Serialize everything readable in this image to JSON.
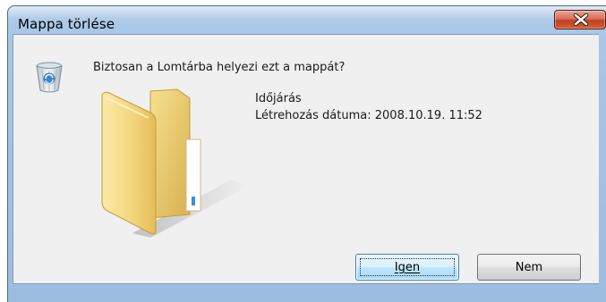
{
  "window": {
    "title": "Mappa törlése"
  },
  "dialog": {
    "question": "Biztosan a Lomtárba helyezi ezt a mappát?",
    "folder_name": "Időjárás",
    "created_label": "Létrehozás dátuma:",
    "created_value": "2008.10.19. 11:52"
  },
  "buttons": {
    "yes": "Igen",
    "no": "Nem"
  },
  "icons": {
    "close": "close-icon",
    "recycle_bin": "recycle-bin-icon",
    "folder": "folder-icon"
  },
  "colors": {
    "title_bar": "#a9c7e6",
    "close_button": "#c33e22",
    "dialog_background": "#f0f0f0",
    "default_button_border": "#3c7fb1"
  }
}
